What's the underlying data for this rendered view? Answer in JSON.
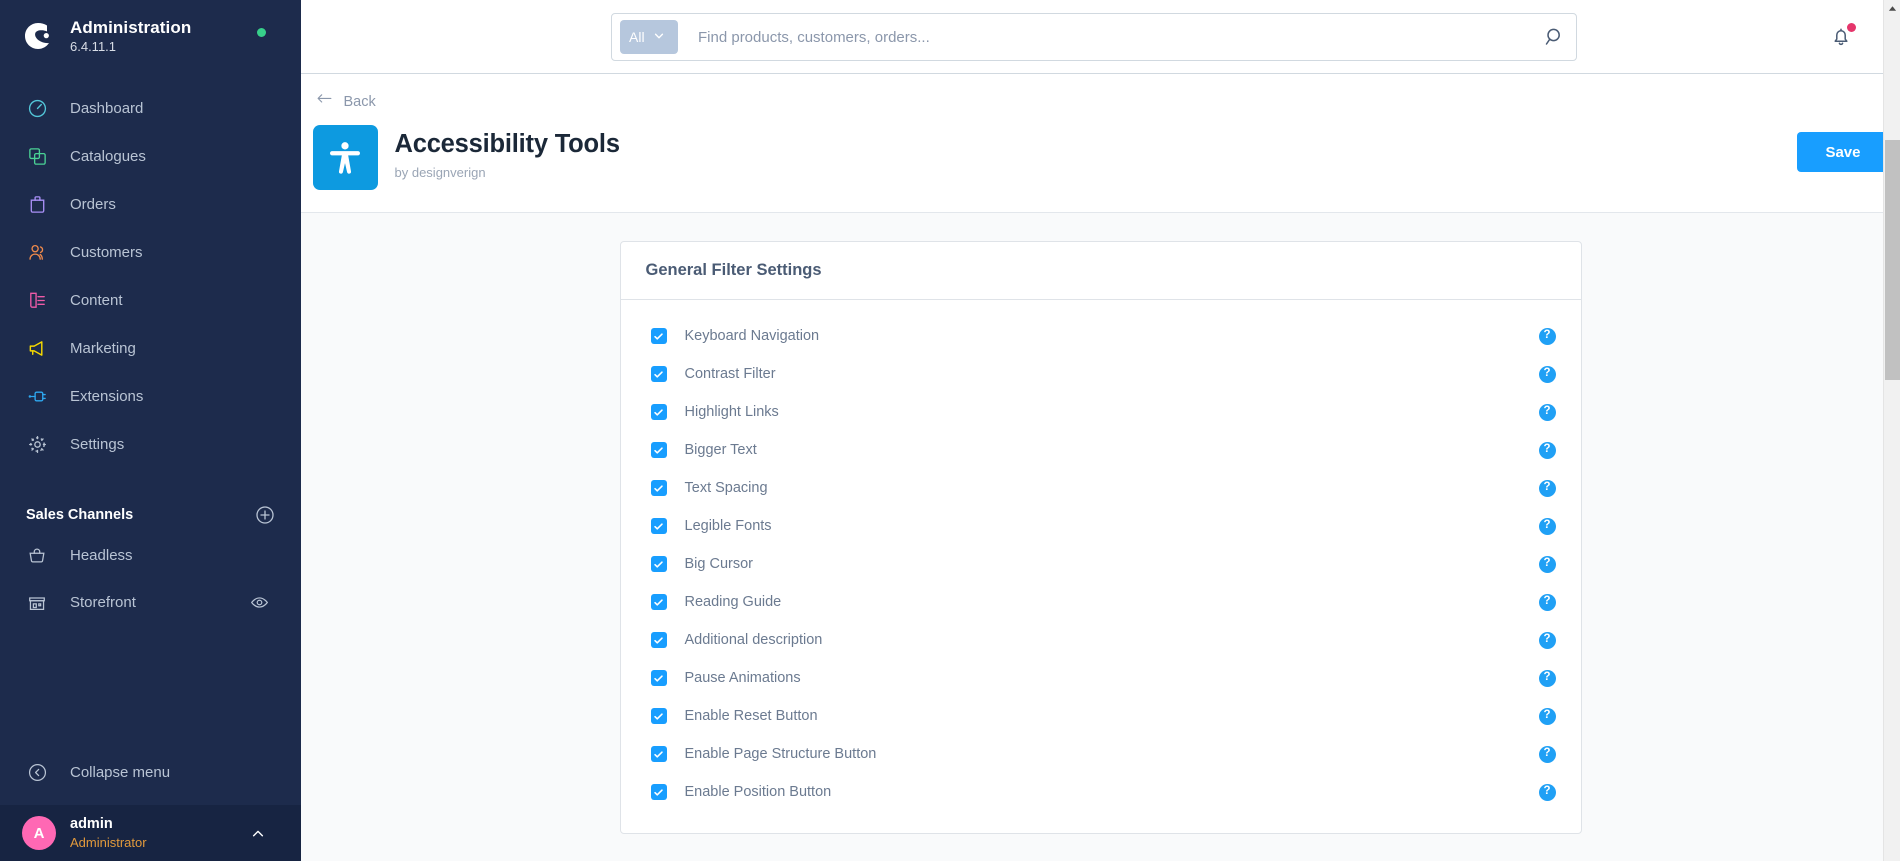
{
  "sidebar": {
    "brand": {
      "title": "Administration",
      "version": "6.4.11.1",
      "status": "online"
    },
    "items": [
      {
        "label": "Dashboard",
        "icon": "dashboard-icon",
        "color": "#53c7d9"
      },
      {
        "label": "Catalogues",
        "icon": "catalogues-icon",
        "color": "#4ad295"
      },
      {
        "label": "Orders",
        "icon": "orders-icon",
        "color": "#a990f7"
      },
      {
        "label": "Customers",
        "icon": "customers-icon",
        "color": "#f08a4b"
      },
      {
        "label": "Content",
        "icon": "content-icon",
        "color": "#f05ba8"
      },
      {
        "label": "Marketing",
        "icon": "marketing-icon",
        "color": "#f5d800"
      },
      {
        "label": "Extensions",
        "icon": "extensions-icon",
        "color": "#2ea8f0"
      },
      {
        "label": "Settings",
        "icon": "gear-icon",
        "color": "#b9c4d4"
      }
    ],
    "sales_channels": {
      "title": "Sales Channels",
      "add_label": "plus-icon",
      "items": [
        {
          "label": "Headless",
          "icon": "basket-icon"
        },
        {
          "label": "Storefront",
          "icon": "storefront-icon",
          "action_icon": "eye-icon"
        }
      ]
    },
    "collapse": {
      "label": "Collapse menu",
      "icon": "chevron-left-circle-icon"
    },
    "user": {
      "initial": "A",
      "name": "admin",
      "role": "Administrator",
      "caret": "chevron-up-icon"
    }
  },
  "topbar": {
    "search": {
      "scope_label": "All",
      "scope_caret": "chevron-down-icon",
      "placeholder": "Find products, customers, orders...",
      "value": "",
      "go_icon": "search-icon"
    },
    "notifications": {
      "icon": "bell-icon",
      "has_unread": true,
      "dot_color": "#e5356b"
    }
  },
  "page": {
    "back_label": "Back",
    "back_icon": "arrow-left-icon",
    "app_icon": "accessibility-icon",
    "app_icon_color": "#0d9ae0",
    "title": "Accessibility Tools",
    "subtitle": "by designverign",
    "save_label": "Save",
    "save_color": "#189eff"
  },
  "card": {
    "title": "General Filter Settings",
    "help_icon": "question-mark-icon",
    "accent": "#189eff",
    "options": [
      {
        "label": "Keyboard Navigation",
        "checked": true
      },
      {
        "label": "Contrast Filter",
        "checked": true
      },
      {
        "label": "Highlight Links",
        "checked": true
      },
      {
        "label": "Bigger Text",
        "checked": true
      },
      {
        "label": "Text Spacing",
        "checked": true
      },
      {
        "label": "Legible Fonts",
        "checked": true
      },
      {
        "label": "Big Cursor",
        "checked": true
      },
      {
        "label": "Reading Guide",
        "checked": true
      },
      {
        "label": "Additional description",
        "checked": true
      },
      {
        "label": "Pause Animations",
        "checked": true
      },
      {
        "label": "Enable Reset Button",
        "checked": true
      },
      {
        "label": "Enable Page Structure Button",
        "checked": true
      },
      {
        "label": "Enable Position Button",
        "checked": true
      }
    ]
  },
  "scrollbar": {
    "up_arrow_icon": "triangle-up-icon"
  }
}
